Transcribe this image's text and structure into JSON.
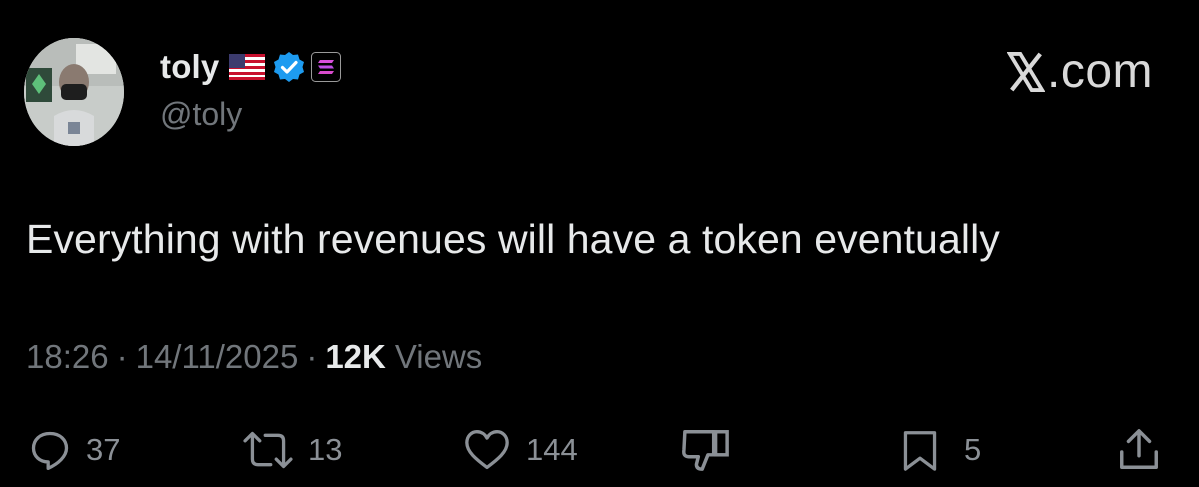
{
  "author": {
    "display_name": "toly",
    "handle": "@toly",
    "flag_icon": "us-flag-icon",
    "verified_icon": "verified-badge-icon",
    "affiliate_icon": "solana-logo-icon"
  },
  "brand": {
    "label": ".com",
    "icon": "x-logo-icon"
  },
  "tweet": {
    "text": "Everything with revenues will have a token eventually",
    "time": "18:26",
    "date": "14/11/2025",
    "views_count": "12K",
    "views_label": "Views",
    "separator": "·"
  },
  "actions": {
    "replies": "37",
    "reposts": "13",
    "likes": "144",
    "bookmarks": "5"
  },
  "colors": {
    "background": "#000000",
    "primary_text": "#e7e9ea",
    "secondary_text": "#71767b",
    "verified_blue": "#1d9bf0"
  }
}
